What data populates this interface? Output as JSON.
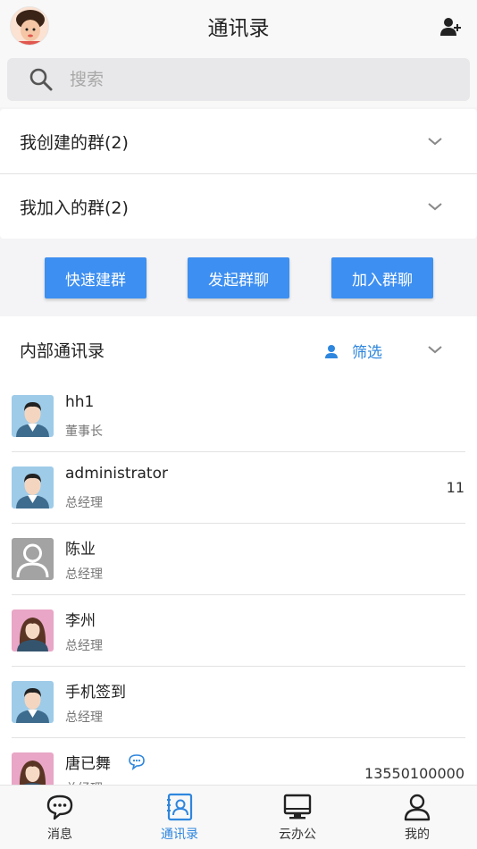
{
  "header": {
    "title": "通讯录"
  },
  "search": {
    "placeholder": "搜索"
  },
  "groups": [
    {
      "label": "我创建的群(2)"
    },
    {
      "label": "我加入的群(2)"
    }
  ],
  "actions": {
    "quick_create": "快速建群",
    "start_chat": "发起群聊",
    "join_chat": "加入群聊"
  },
  "contacts_section": {
    "title": "内部通讯录",
    "filter_label": "筛选"
  },
  "contacts": [
    {
      "name": "hh1",
      "role": "董事长",
      "right": "",
      "avatar": "male"
    },
    {
      "name": "administrator",
      "role": "总经理",
      "right": "11",
      "avatar": "male"
    },
    {
      "name": "陈业",
      "role": "总经理",
      "right": "",
      "avatar": "default"
    },
    {
      "name": "李州",
      "role": "总经理",
      "right": "",
      "avatar": "female"
    },
    {
      "name": "手机签到",
      "role": "总经理",
      "right": "",
      "avatar": "male"
    },
    {
      "name": "唐已舞",
      "role": "总经理",
      "right": "13550100000",
      "avatar": "female"
    }
  ],
  "tabs": [
    {
      "label": "消息",
      "icon": "message-icon"
    },
    {
      "label": "通讯录",
      "icon": "contacts-icon",
      "active": true
    },
    {
      "label": "云办公",
      "icon": "cloud-office-icon"
    },
    {
      "label": "我的",
      "icon": "profile-icon"
    }
  ],
  "colors": {
    "accent": "#3d8ff1",
    "link": "#2e86de"
  }
}
